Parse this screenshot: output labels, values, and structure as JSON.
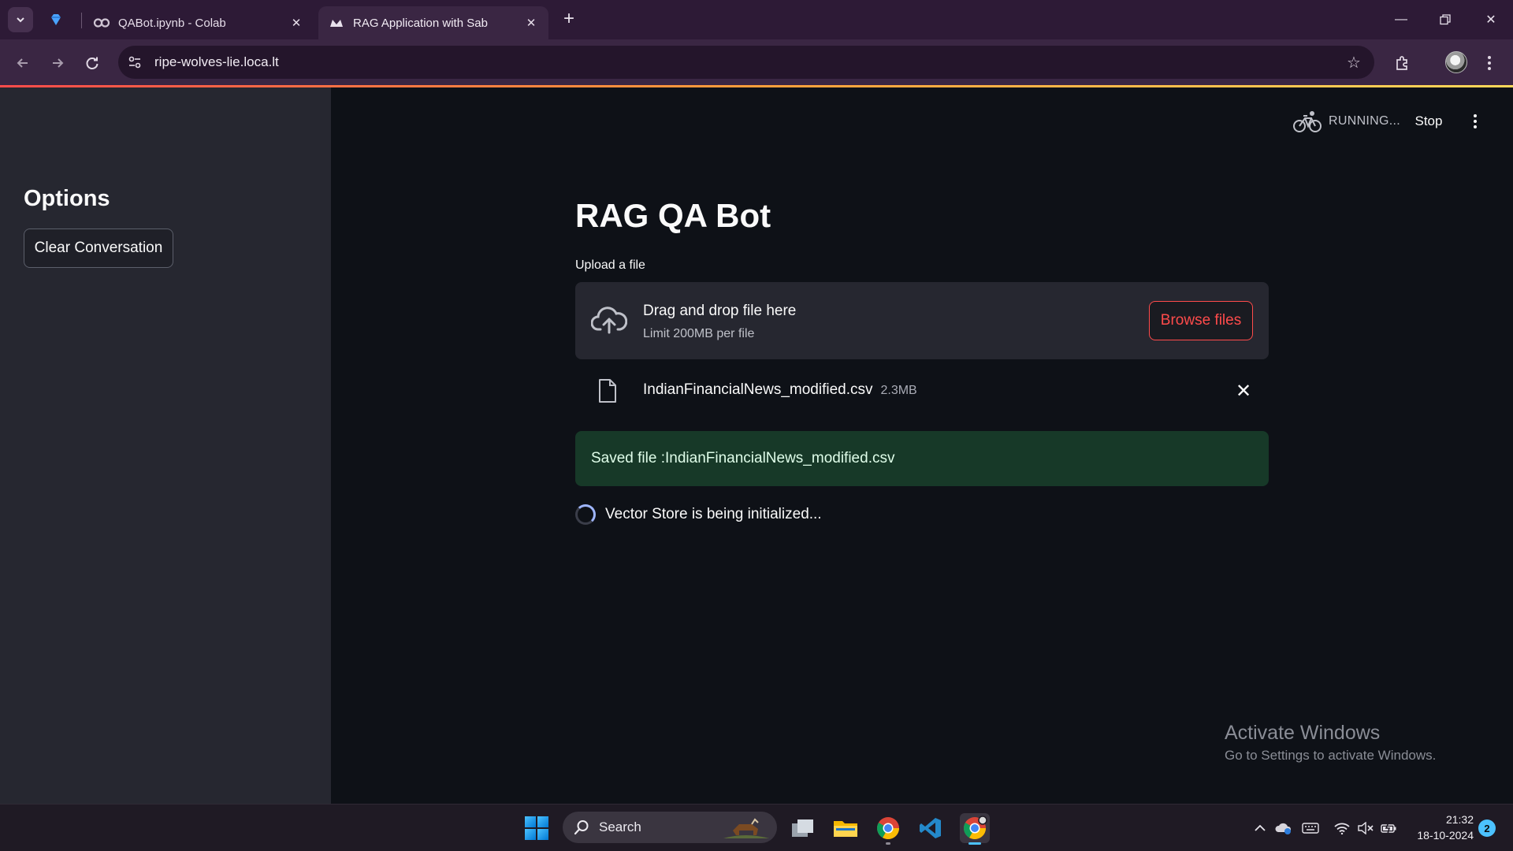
{
  "browser": {
    "tabs": [
      {
        "title": "QABot.ipynb - Colab",
        "active": false,
        "favicon": "colab-icon"
      },
      {
        "title": "RAG Application with Sab",
        "active": true,
        "favicon": "streamlit-icon"
      }
    ],
    "url": "ripe-wolves-lie.loca.lt",
    "accent_gradient": [
      "#ff4b4b",
      "#ff9f3b",
      "#ffd85a"
    ]
  },
  "sidebar": {
    "title": "Options",
    "clear_button": "Clear Conversation"
  },
  "status": {
    "running": "RUNNING...",
    "stop": "Stop"
  },
  "main": {
    "title": "RAG QA Bot",
    "upload_label": "Upload a file",
    "dropzone": {
      "title": "Drag and drop file here",
      "limit": "Limit 200MB per file",
      "browse": "Browse files"
    },
    "file": {
      "name": "IndianFinancialNews_modified.csv",
      "size": "2.3MB"
    },
    "success": "Saved file :IndianFinancialNews_modified.csv",
    "spinner": "Vector Store is being initialized..."
  },
  "watermark": {
    "title": "Activate Windows",
    "subtitle": "Go to Settings to activate Windows."
  },
  "taskbar": {
    "search_placeholder": "Search",
    "time": "21:32",
    "date": "18-10-2024",
    "notification_count": "2"
  },
  "colors": {
    "primary": "#ff4b4b",
    "background": "#0e1117",
    "sidebar": "#262730",
    "success_bg": "#173928"
  }
}
